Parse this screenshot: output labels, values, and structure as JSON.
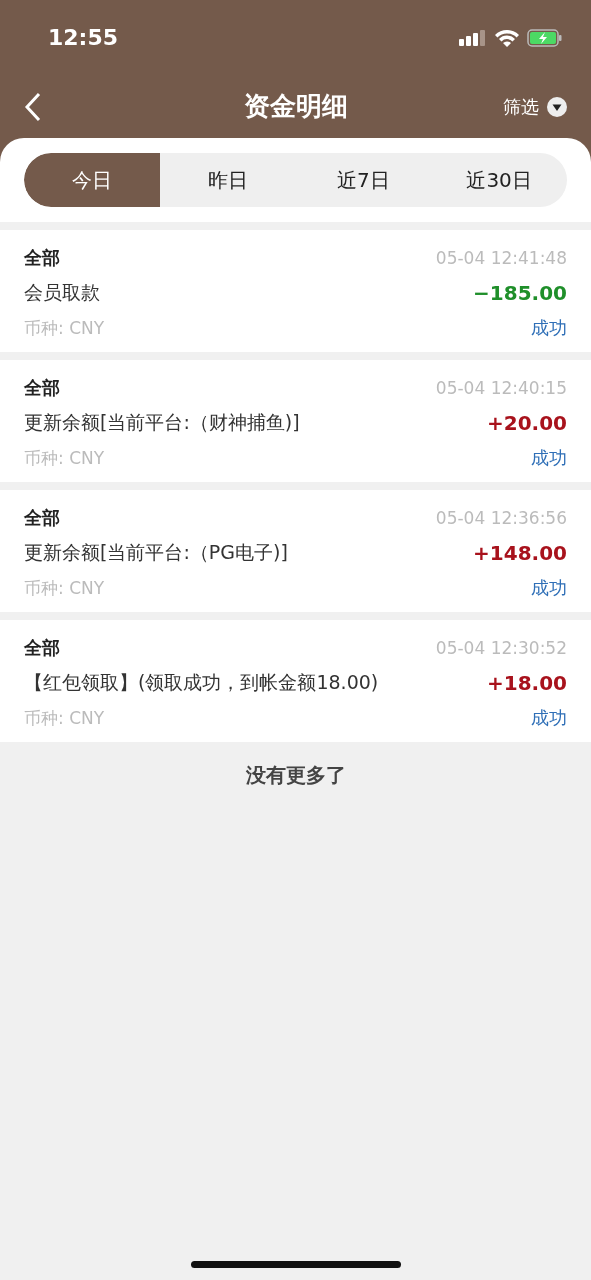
{
  "status_bar": {
    "time": "12:55"
  },
  "header": {
    "title": "资金明细",
    "filter": "筛选"
  },
  "tabs": [
    {
      "label": "今日",
      "selected": true
    },
    {
      "label": "昨日",
      "selected": false
    },
    {
      "label": "近7日",
      "selected": false
    },
    {
      "label": "近30日",
      "selected": false
    }
  ],
  "transactions": [
    {
      "category": "全部",
      "time": "05-04 12:41:48",
      "description": "会员取款",
      "amount": "−185.00",
      "color": "#1f8f2a",
      "currency": "币种: CNY",
      "status": "成功"
    },
    {
      "category": "全部",
      "time": "05-04 12:40:15",
      "description": "更新余额[当前平台:（财神捕鱼)]",
      "amount": "+20.00",
      "color": "#a8121c",
      "currency": "币种: CNY",
      "status": "成功"
    },
    {
      "category": "全部",
      "time": "05-04 12:36:56",
      "description": "更新余额[当前平台:（PG电子)]",
      "amount": "+148.00",
      "color": "#a8121c",
      "currency": "币种: CNY",
      "status": "成功"
    },
    {
      "category": "全部",
      "time": "05-04 12:30:52",
      "description": "【红包领取】(领取成功，到帐金额18.00)",
      "amount": "+18.00",
      "color": "#a8121c",
      "currency": "币种: CNY",
      "status": "成功"
    }
  ],
  "footer": "没有更多了"
}
